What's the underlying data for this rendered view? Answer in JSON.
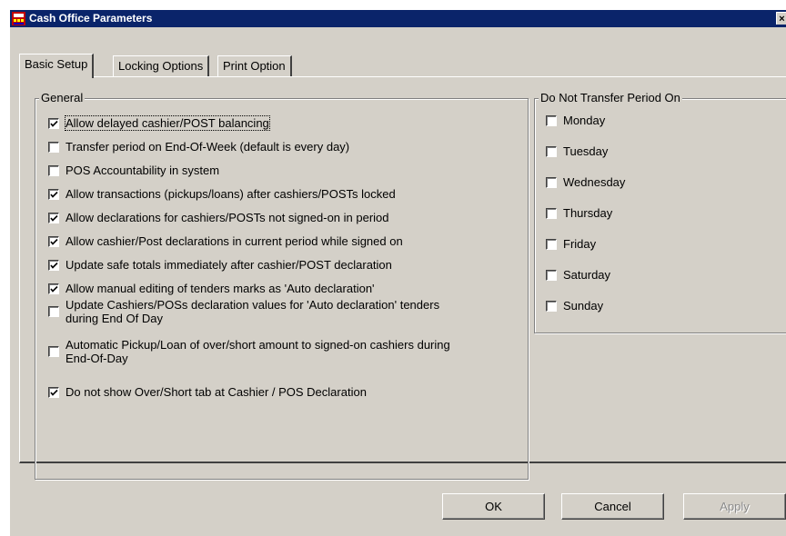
{
  "window": {
    "title": "Cash Office Parameters",
    "close_glyph": "×",
    "title_bar_color": "#0a246a",
    "face_color": "#d4d0c8"
  },
  "tabs": [
    {
      "label": "Basic Setup",
      "active": true
    },
    {
      "label": "Locking Options",
      "active": false
    },
    {
      "label": "Print Option",
      "active": false
    }
  ],
  "general": {
    "title": "General",
    "options": [
      {
        "label": "Allow delayed cashier/POST balancing",
        "checked": true
      },
      {
        "label": "Transfer period on End-Of-Week (default is every day)",
        "checked": false
      },
      {
        "label": "POS Accountability in system",
        "checked": false
      },
      {
        "label": "Allow transactions (pickups/loans) after cashiers/POSTs locked",
        "checked": true
      },
      {
        "label": "Allow declarations for cashiers/POSTs not signed-on in period",
        "checked": true
      },
      {
        "label": "Allow cashier/Post declarations in current period while signed on",
        "checked": true
      },
      {
        "label": "Update safe totals immediately after cashier/POST declaration",
        "checked": true
      },
      {
        "label": "Allow manual editing of tenders marks as 'Auto declaration'",
        "checked": true
      },
      {
        "label": "Update Cashiers/POSs declaration values for 'Auto declaration' tenders",
        "label_line2": "during End Of Day",
        "checked": false
      },
      {
        "label": "Automatic Pickup/Loan of over/short amount to signed-on cashiers during",
        "label_line2": "End-Of-Day",
        "checked": false
      },
      {
        "label": "Do not show Over/Short tab at Cashier / POS Declaration",
        "checked": true
      }
    ]
  },
  "no_transfer": {
    "title": "Do Not Transfer Period On",
    "days": [
      {
        "label": "Monday",
        "checked": false
      },
      {
        "label": "Tuesday",
        "checked": false
      },
      {
        "label": "Wednesday",
        "checked": false
      },
      {
        "label": "Thursday",
        "checked": false
      },
      {
        "label": "Friday",
        "checked": false
      },
      {
        "label": "Saturday",
        "checked": false
      },
      {
        "label": "Sunday",
        "checked": false
      }
    ]
  },
  "buttons": {
    "ok": "OK",
    "cancel": "Cancel",
    "apply": "Apply"
  }
}
